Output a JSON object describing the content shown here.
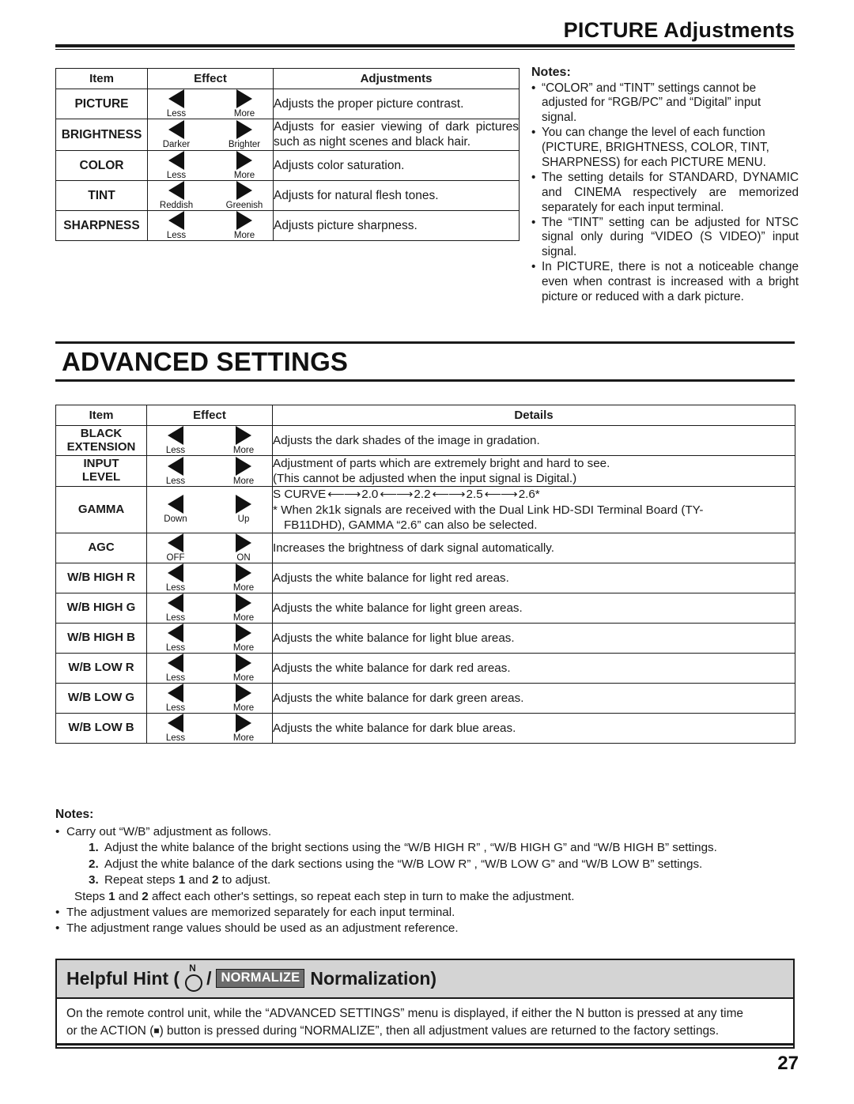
{
  "header": {
    "title": "PICTURE Adjustments"
  },
  "picture_table": {
    "columns": [
      "Item",
      "Effect",
      "Adjustments"
    ],
    "rows": [
      {
        "item": "PICTURE",
        "left_label": "Less",
        "right_label": "More",
        "description": "Adjusts the proper picture contrast.",
        "justify": false
      },
      {
        "item": "BRIGHTNESS",
        "left_label": "Darker",
        "right_label": "Brighter",
        "description": "Adjusts for easier viewing of dark pictures such as night scenes and black hair.",
        "justify": true
      },
      {
        "item": "COLOR",
        "left_label": "Less",
        "right_label": "More",
        "description": "Adjusts color saturation.",
        "justify": false
      },
      {
        "item": "TINT",
        "left_label": "Reddish",
        "right_label": "Greenish",
        "description": "Adjusts for natural flesh tones.",
        "justify": false
      },
      {
        "item": "SHARPNESS",
        "left_label": "Less",
        "right_label": "More",
        "description": "Adjusts picture sharpness.",
        "justify": false
      }
    ]
  },
  "picture_notes": {
    "title": "Notes:",
    "bullet": "•",
    "items": [
      "“COLOR” and “TINT” settings cannot be adjusted for “RGB/PC” and “Digital” input signal.",
      "You can change the level of each function (PICTURE, BRIGHTNESS, COLOR, TINT, SHARPNESS) for each PICTURE MENU.",
      "The setting details for STANDARD, DYNAMIC and CINEMA respectively are memorized separately for each input terminal.",
      "The “TINT” setting can be adjusted for NTSC signal only during “VIDEO (S VIDEO)” input signal.",
      "In PICTURE, there is not a noticeable change even when contrast is increased with a bright picture or reduced with a dark picture."
    ]
  },
  "advanced": {
    "heading": "ADVANCED SETTINGS",
    "columns": [
      "Item",
      "Effect",
      "Details"
    ],
    "rows": [
      {
        "item": "BLACK EXTENSION",
        "left_label": "Less",
        "right_label": "More",
        "lines": [
          "Adjusts the dark shades of the image in gradation."
        ]
      },
      {
        "item": "INPUT LEVEL",
        "left_label": "Less",
        "right_label": "More",
        "lines": [
          "Adjustment of parts which are extremely bright and hard to see.",
          "(This cannot be adjusted when the input signal is Digital.)"
        ]
      },
      {
        "item": "GAMMA",
        "left_label": "Down",
        "right_label": "Up",
        "gamma": {
          "sequence_label": "S CURVE",
          "arrow": "⟵⟶",
          "values": [
            "2.0",
            "2.2",
            "2.5",
            "2.6*"
          ],
          "footnote_line1": "* When 2k1k signals are received with the Dual Link HD-SDI Terminal Board (TY-",
          "footnote_line2": "FB11DHD), GAMMA “2.6” can also be selected."
        }
      },
      {
        "item": "AGC",
        "left_label": "OFF",
        "right_label": "ON",
        "lines": [
          "Increases the brightness of dark signal automatically."
        ]
      },
      {
        "item": "W/B HIGH R",
        "left_label": "Less",
        "right_label": "More",
        "lines": [
          "Adjusts the white balance for light red areas."
        ]
      },
      {
        "item": "W/B HIGH G",
        "left_label": "Less",
        "right_label": "More",
        "lines": [
          "Adjusts the white balance for light green areas."
        ]
      },
      {
        "item": "W/B HIGH B",
        "left_label": "Less",
        "right_label": "More",
        "lines": [
          "Adjusts the white balance for light blue areas."
        ]
      },
      {
        "item": "W/B LOW R",
        "left_label": "Less",
        "right_label": "More",
        "lines": [
          "Adjusts the white balance for dark red areas."
        ]
      },
      {
        "item": "W/B LOW G",
        "left_label": "Less",
        "right_label": "More",
        "lines": [
          "Adjusts the white balance for dark green areas."
        ]
      },
      {
        "item": "W/B LOW B",
        "left_label": "Less",
        "right_label": "More",
        "lines": [
          "Adjusts the white balance for dark blue areas."
        ]
      }
    ]
  },
  "advanced_notes": {
    "title": "Notes:",
    "bullet": "•",
    "line1": "Carry out “W/B” adjustment as follows.",
    "steps": [
      {
        "num": "1.",
        "text": "Adjust the white balance of the bright sections using the “W/B HIGH R” , “W/B HIGH G” and “W/B HIGH B” settings."
      },
      {
        "num": "2.",
        "text": "Adjust the white balance of the dark sections using the “W/B LOW R” , “W/B LOW G” and “W/B LOW B” settings."
      },
      {
        "num": "3.",
        "text": "Repeat steps 1 and 2 to adjust."
      }
    ],
    "steps_note": "Steps 1 and 2 affect each other's settings, so repeat each step in turn to make the adjustment.",
    "line2": "The adjustment values are memorized separately for each input terminal.",
    "line3": "The adjustment range values should be used as an adjustment reference."
  },
  "hint": {
    "prefix": "Helpful Hint (",
    "n_label": "N",
    "slash": "/",
    "badge": "NORMALIZE",
    "suffix": "Normalization)",
    "body_line1": "On the remote control unit, while the “ADVANCED SETTINGS” menu is displayed, if either the N button is pressed at any time",
    "body_line2_a": "or the ACTION (",
    "body_line2_square": "■",
    "body_line2_b": ") button is pressed during “NORMALIZE”, then all adjustment values are returned to the factory settings."
  },
  "footer": {
    "page_number": "27"
  },
  "colors": {
    "ink": "#1a1a1a",
    "hint_header_bg": "#d4d4d4",
    "badge_bg": "#6d6d6d",
    "badge_text": "#ffffff"
  }
}
